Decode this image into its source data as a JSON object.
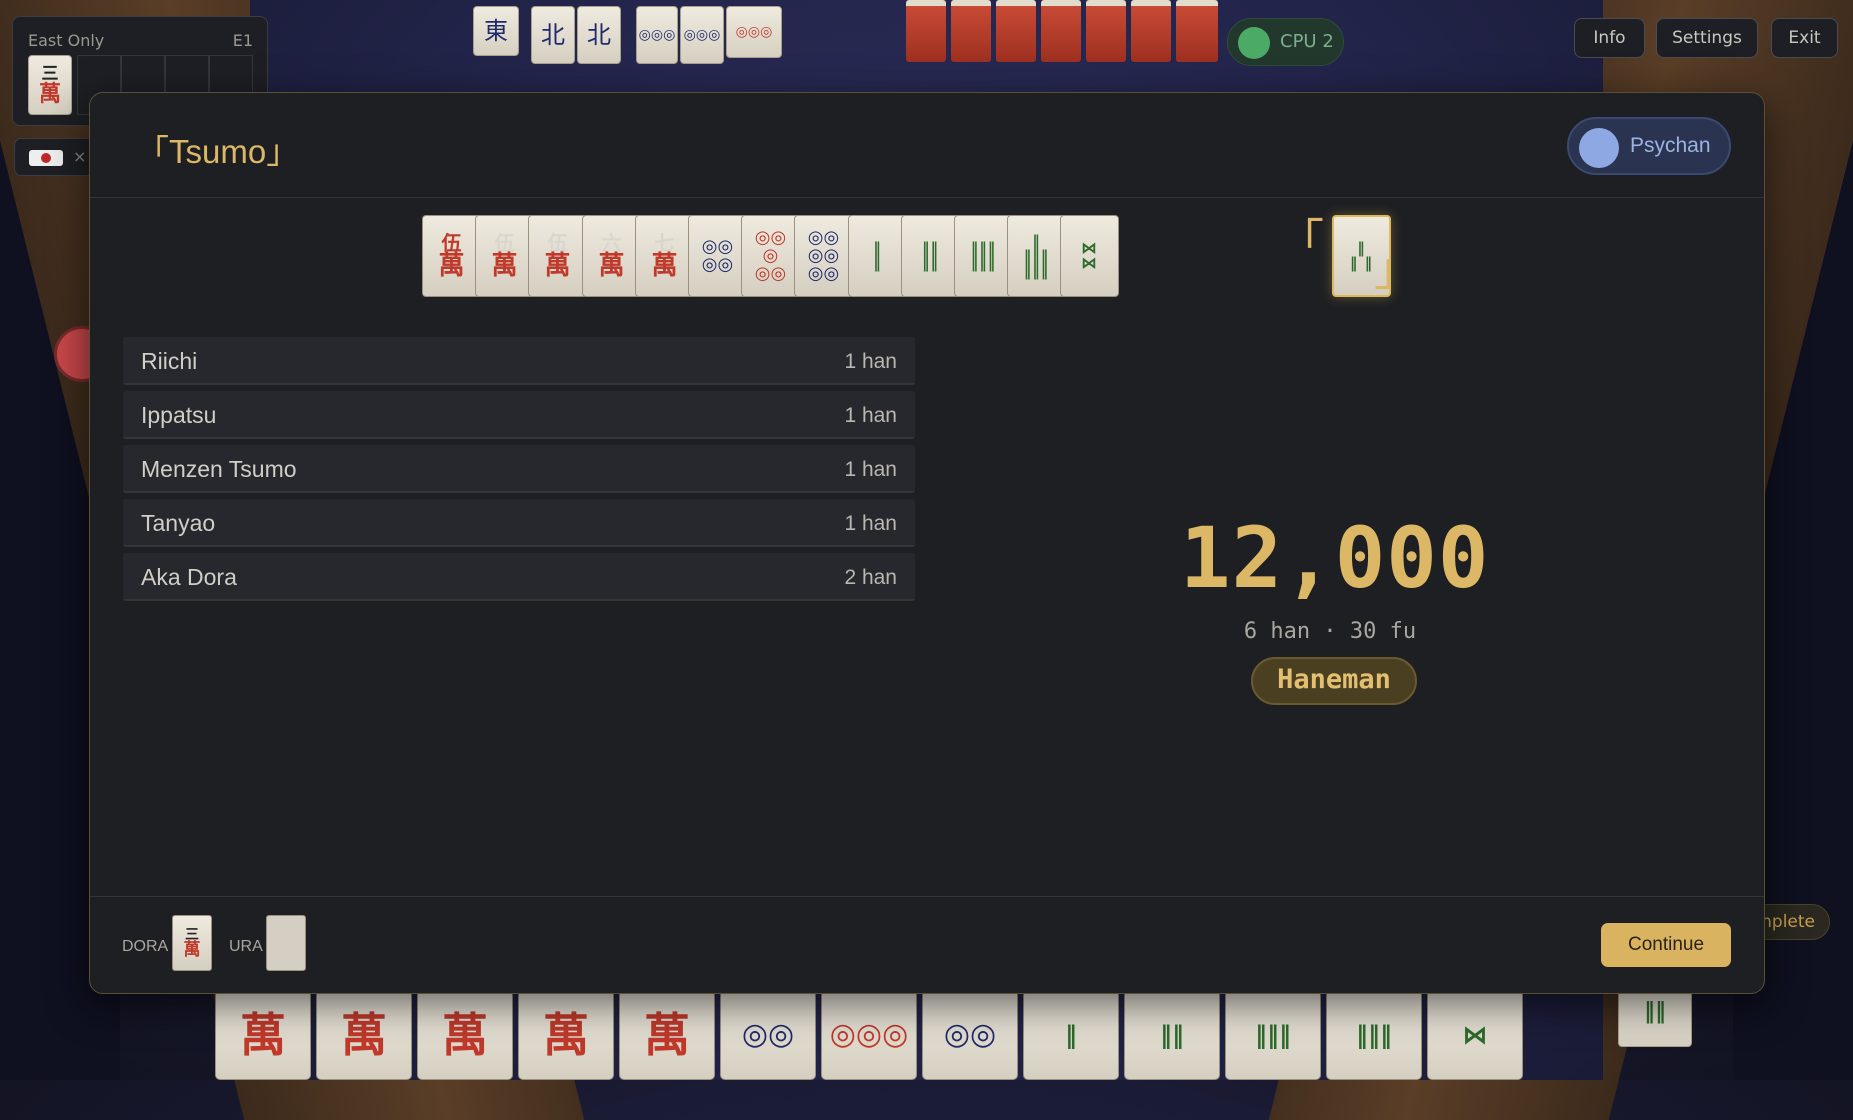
{
  "hud": {
    "round_label": "East Only",
    "round_id": "E1",
    "round_tile": {
      "num": "三",
      "suit": "萬"
    },
    "flag_close": "×",
    "cpu_label": "CPU 2",
    "buttons": {
      "info": "Info",
      "settings": "Settings",
      "exit": "Exit"
    },
    "complete_label": "nplete"
  },
  "modal": {
    "title": "「Tsumo」",
    "winner": "Psychan",
    "hand": [
      {
        "num": "伍",
        "suit": "萬",
        "red": true
      },
      {
        "num": "伍",
        "suit": "萬",
        "red": false
      },
      {
        "num": "伍",
        "suit": "萬",
        "red": false
      },
      {
        "num": "六",
        "suit": "萬",
        "red": false
      },
      {
        "num": "七",
        "suit": "萬",
        "red": false
      },
      {
        "pin": "◎◎\n◎◎"
      },
      {
        "pin": "◎◎\n◎\n◎◎",
        "red": true
      },
      {
        "pin": "◎◎\n◎◎\n◎◎"
      },
      {
        "sou": "‖\n‖"
      },
      {
        "sou": "‖‖\n‖‖"
      },
      {
        "sou": "‖‖‖\n‖‖‖"
      },
      {
        "sou": "‖\n‖‖‖\n‖‖‖"
      },
      {
        "sou": "⋈\n⋈"
      }
    ],
    "winning_tile": {
      "sou": "‖\n‖ ‖"
    },
    "bracket_open": "「",
    "bracket_close": "」",
    "yaku": [
      {
        "name": "Riichi",
        "han": "1 han"
      },
      {
        "name": "Ippatsu",
        "han": "1 han"
      },
      {
        "name": "Menzen Tsumo",
        "han": "1 han"
      },
      {
        "name": "Tanyao",
        "han": "1 han"
      },
      {
        "name": "Aka Dora",
        "han": "2 han"
      }
    ],
    "score": "12,000",
    "score_detail": "6 han · 30 fu",
    "limit": "Haneman",
    "dora_label": "DORA",
    "dora_tile": {
      "num": "三",
      "suit": "萬"
    },
    "ura_label": "URA",
    "continue_label": "Continue"
  },
  "player_hand": [
    {
      "man": "萬"
    },
    {
      "man": "萬"
    },
    {
      "man": "萬"
    },
    {
      "man": "萬"
    },
    {
      "man": "萬"
    },
    {
      "pin": "◎◎"
    },
    {
      "pin": "◎◎◎"
    },
    {
      "pin": "◎◎"
    },
    {
      "sou": "‖"
    },
    {
      "sou": "‖‖"
    },
    {
      "sou": "‖‖‖"
    },
    {
      "sou": "‖‖‖"
    },
    {
      "sou": "⋈"
    }
  ],
  "colors": {
    "accent_gold": "#dcb866",
    "modal_bg": "#1e1f23",
    "man_red": "#c0392b",
    "sou_green": "#2d6b2d",
    "pin_blue": "#1f2a6b",
    "winner_blue": "#8ea8e4",
    "cpu_green": "#4caa67"
  }
}
